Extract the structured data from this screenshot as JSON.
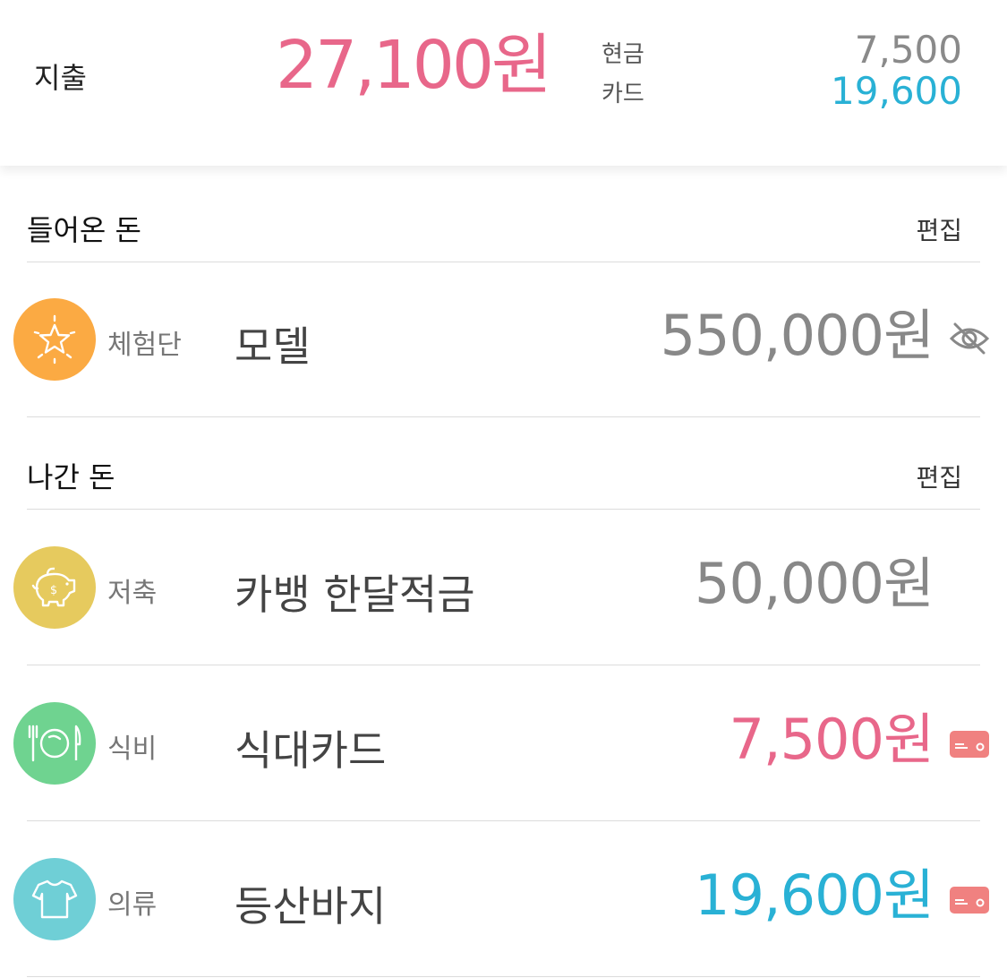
{
  "summary": {
    "title": "지출",
    "total": "27,100원",
    "cash_label": "현금",
    "cash_value": "7,500",
    "card_label": "카드",
    "card_value": "19,600"
  },
  "income": {
    "title": "들어온 돈",
    "edit_label": "편집",
    "items": [
      {
        "icon": "star-icon",
        "category": "체험단",
        "description": "모델",
        "amount": "550,000원",
        "color": "#888888",
        "badge": "eye-slash-icon"
      }
    ]
  },
  "expense": {
    "title": "나간 돈",
    "edit_label": "편집",
    "items": [
      {
        "icon": "piggy-bank-icon",
        "category": "저축",
        "description": "카뱅 한달적금",
        "amount": "50,000원",
        "color": "#888888"
      },
      {
        "icon": "plate-icon",
        "category": "식비",
        "description": "식대카드",
        "amount": "7,500원",
        "color": "#e8678a",
        "badge": "card-icon"
      },
      {
        "icon": "shirt-icon",
        "category": "의류",
        "description": "등산바지",
        "amount": "19,600원",
        "color": "#29b1d5",
        "badge": "card-icon"
      }
    ]
  },
  "colors": {
    "pink": "#e8678a",
    "blue": "#29b1d5",
    "orange": "#fbaa43",
    "yellow": "#e6ca5e",
    "green": "#6fd390",
    "teal": "#6fcfd6",
    "card_badge": "#f08180"
  }
}
